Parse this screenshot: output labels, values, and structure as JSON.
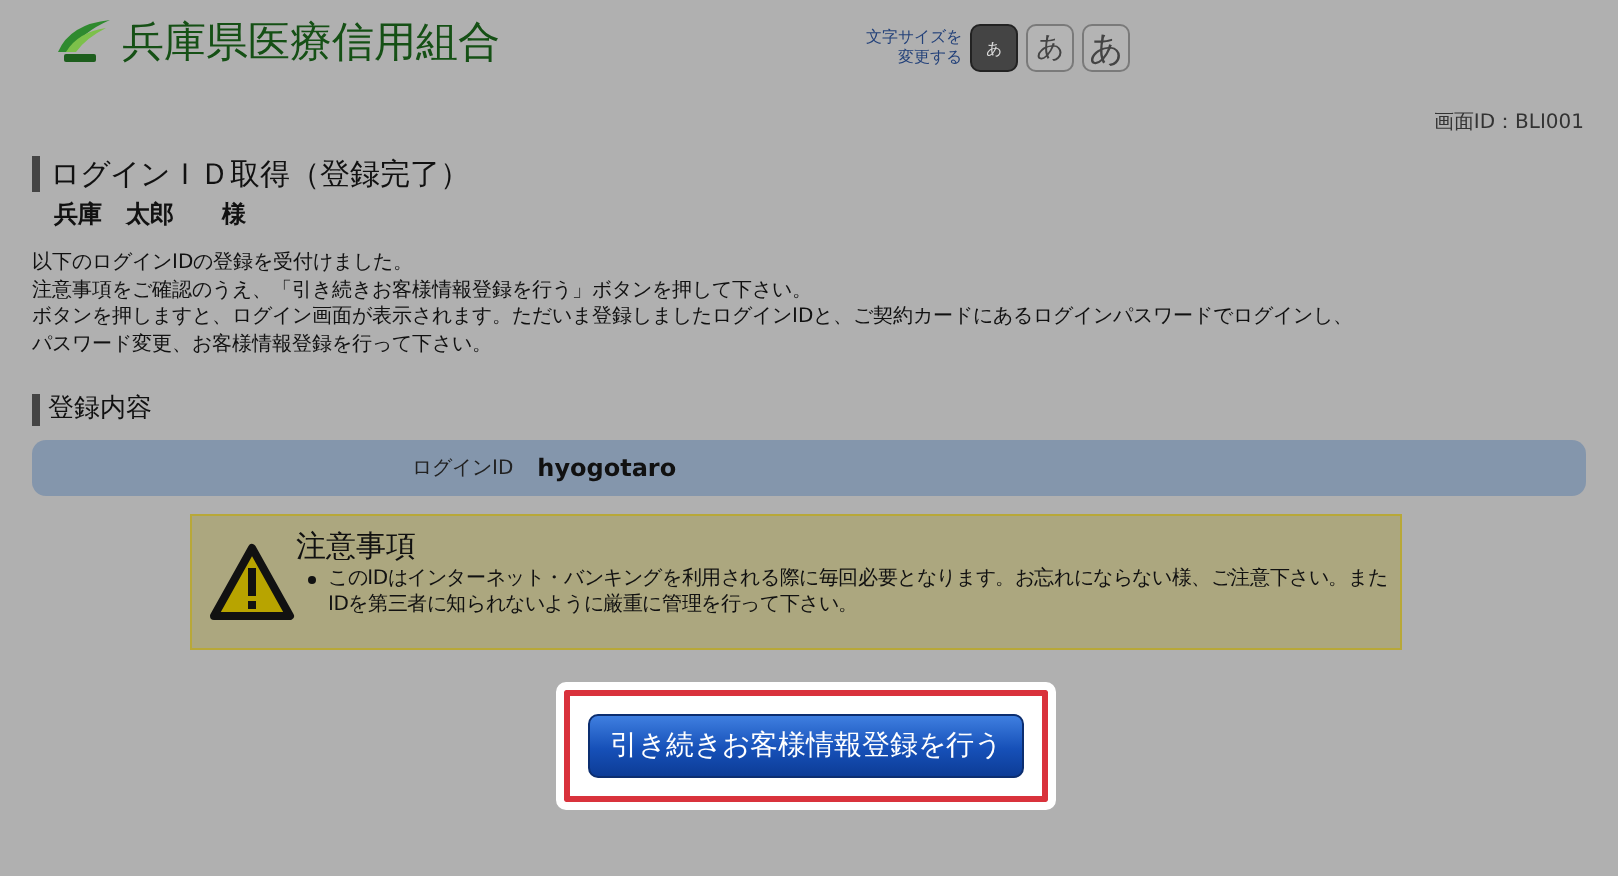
{
  "header": {
    "site_title": "兵庫県医療信用組合",
    "font_size_label": "文字サイズを変更する",
    "font_sizes": [
      {
        "label": "あ",
        "kind": "small",
        "selected": true
      },
      {
        "label": "あ",
        "kind": "medium",
        "selected": false
      },
      {
        "label": "あ",
        "kind": "large",
        "selected": false
      }
    ]
  },
  "screen_id": "画面ID：BLI001",
  "page_title": "ログインＩＤ取得（登録完了）",
  "customer_name": "兵庫　太郎　　様",
  "message_lines": [
    "以下のログインIDの登録を受付けました。",
    "注意事項をご確認のうえ、「引き続きお客様情報登録を行う」ボタンを押して下さい。",
    "ボタンを押しますと、ログイン画面が表示されます。ただいま登録しましたログインIDと、ご契約カードにあるログインパスワードでログインし、",
    "パスワード変更、お客様情報登録を行って下さい。"
  ],
  "section_title": "登録内容",
  "login_id": {
    "label": "ログインID",
    "value": "hyogotaro"
  },
  "notice": {
    "title": "注意事項",
    "items": [
      "このIDはインターネット・バンキングを利用される際に毎回必要となります。お忘れにならない様、ご注意下さい。またIDを第三者に知られないように厳重に管理を行って下さい。"
    ]
  },
  "continue_button": {
    "label": "引き続きお客様情報登録を行う",
    "highlighted": true
  }
}
